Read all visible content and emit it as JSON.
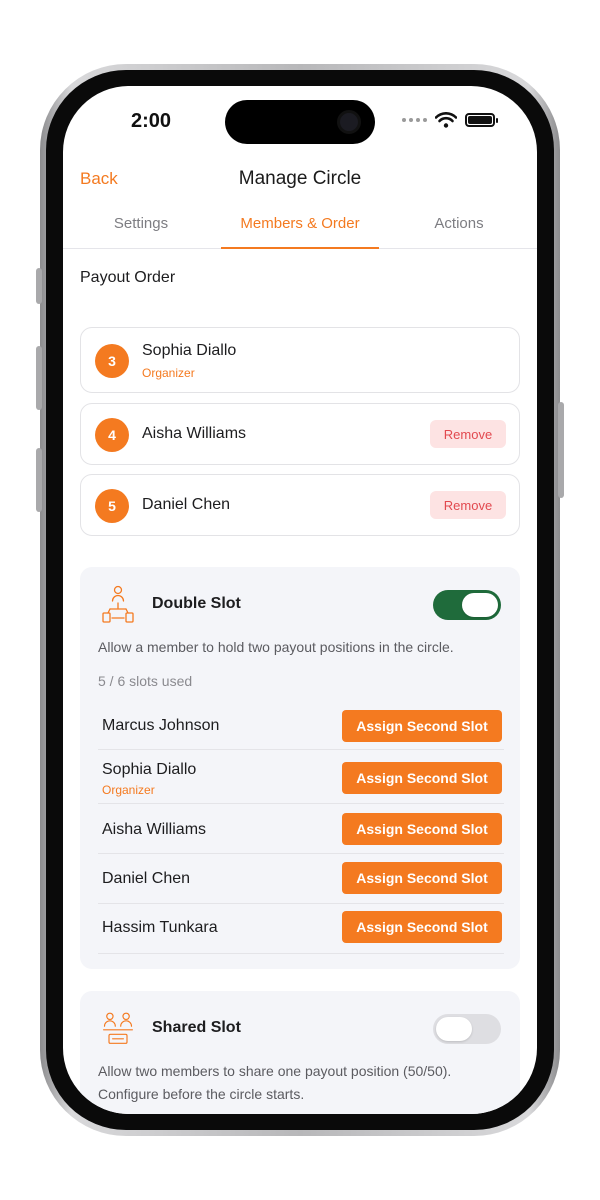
{
  "status_bar": {
    "time": "2:00"
  },
  "nav": {
    "back_label": "Back",
    "title": "Manage Circle"
  },
  "tabs": [
    {
      "label": "Settings"
    },
    {
      "label": "Members & Order"
    },
    {
      "label": "Actions"
    }
  ],
  "payout_order": {
    "title": "Payout Order",
    "members": [
      {
        "position": "3",
        "name": "Sophia Diallo",
        "role": "Organizer"
      },
      {
        "position": "4",
        "name": "Aisha Williams",
        "action": "Remove"
      },
      {
        "position": "5",
        "name": "Daniel Chen",
        "action": "Remove"
      }
    ]
  },
  "double_slot": {
    "title": "Double Slot",
    "enabled": true,
    "description": "Allow a member to hold two payout positions in the circle.",
    "slots_used": "5 / 6 slots used",
    "rows": [
      {
        "name": "Marcus Johnson",
        "action": "Assign Second Slot"
      },
      {
        "name": "Sophia Diallo",
        "role": "Organizer",
        "action": "Assign Second Slot"
      },
      {
        "name": "Aisha Williams",
        "action": "Assign Second Slot"
      },
      {
        "name": "Daniel Chen",
        "action": "Assign Second Slot"
      },
      {
        "name": "Hassim Tunkara",
        "action": "Assign Second Slot"
      }
    ]
  },
  "shared_slot": {
    "title": "Shared Slot",
    "enabled": false,
    "description": "Allow two members to share one payout position (50/50). Configure before the circle starts."
  },
  "colors": {
    "accent": "#f47a20",
    "toggle_on": "#1f6b3b",
    "remove_bg": "#fde3e3",
    "remove_text": "#e2494f"
  }
}
